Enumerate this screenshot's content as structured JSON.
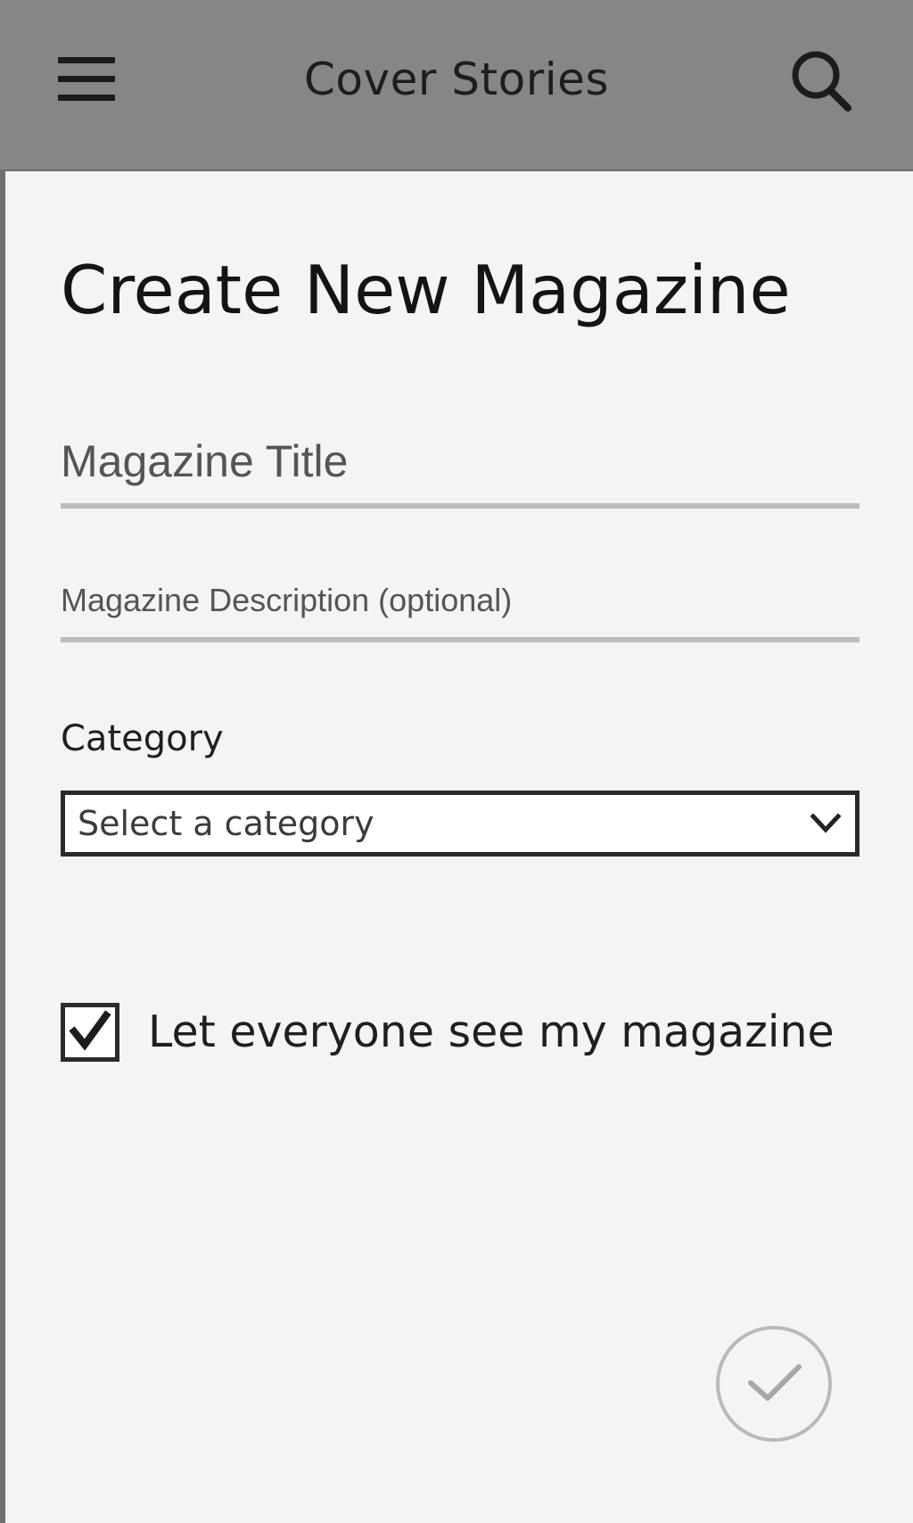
{
  "header": {
    "title": "Cover Stories",
    "menu_icon": "hamburger-menu-icon",
    "search_icon": "search-icon",
    "background_color": "#868686"
  },
  "page": {
    "title": "Create New Magazine"
  },
  "form": {
    "title_placeholder": "Magazine Title",
    "description_placeholder": "Magazine Description (optional)",
    "category_label": "Category",
    "category_selected": "Select a category",
    "public_checkbox": {
      "label": "Let everyone see my magazine",
      "checked": true,
      "icon": "checkmark-icon"
    },
    "confirm_icon": "confirm-check-icon"
  }
}
